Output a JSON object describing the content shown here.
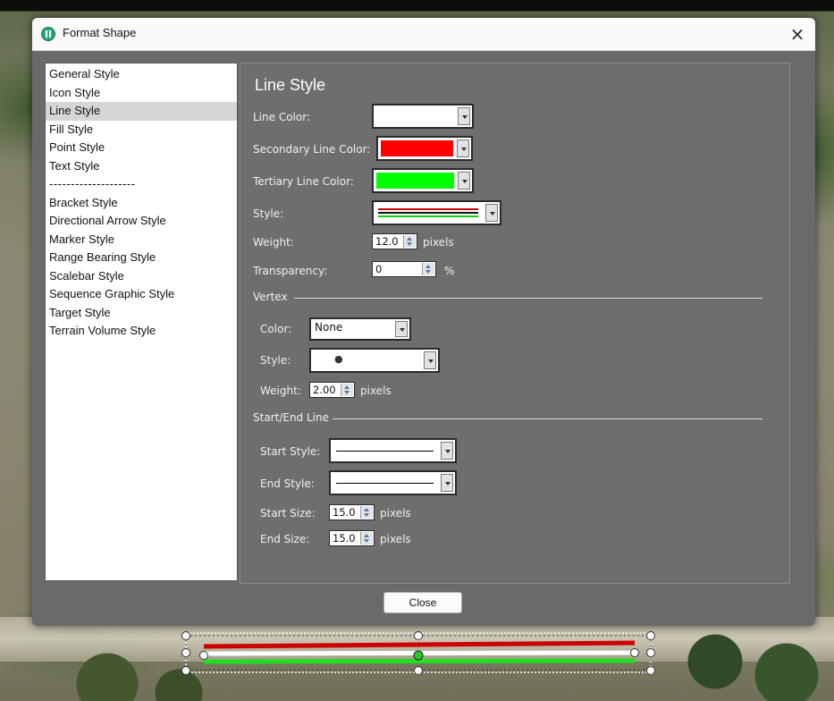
{
  "window": {
    "title": "Format Shape",
    "close_glyph": "×"
  },
  "style_list": {
    "items": [
      {
        "label": "General Style",
        "selected": false
      },
      {
        "label": "Icon Style",
        "selected": false
      },
      {
        "label": "Line Style",
        "selected": true
      },
      {
        "label": "Fill Style",
        "selected": false
      },
      {
        "label": "Point Style",
        "selected": false
      },
      {
        "label": "Text Style",
        "selected": false
      },
      {
        "label": "--------------------",
        "selected": false
      },
      {
        "label": "Bracket Style",
        "selected": false
      },
      {
        "label": "Directional Arrow Style",
        "selected": false
      },
      {
        "label": "Marker Style",
        "selected": false
      },
      {
        "label": "Range Bearing Style",
        "selected": false
      },
      {
        "label": "Scalebar Style",
        "selected": false
      },
      {
        "label": "Sequence Graphic Style",
        "selected": false
      },
      {
        "label": "Target Style",
        "selected": false
      },
      {
        "label": "Terrain Volume Style",
        "selected": false
      }
    ]
  },
  "line_style": {
    "heading": "Line Style",
    "line_color_label": "Line Color:",
    "line_color": "#ffffff",
    "secondary_color_label": "Secondary Line Color:",
    "secondary_color": "#ff0000",
    "tertiary_color_label": "Tertiary Line Color:",
    "tertiary_color": "#00ff00",
    "style_label": "Style:",
    "weight_label": "Weight:",
    "weight_value": "12.0",
    "weight_unit": "pixels",
    "transparency_label": "Transparency:",
    "transparency_value": "0",
    "transparency_unit": "%"
  },
  "vertex": {
    "section_label": "Vertex",
    "color_label": "Color:",
    "color_value": "None",
    "style_label": "Style:",
    "style_glyph": "●",
    "weight_label": "Weight:",
    "weight_value": "2.00",
    "weight_unit": "pixels"
  },
  "start_end": {
    "section_label": "Start/End Line",
    "start_style_label": "Start Style:",
    "end_style_label": "End Style:",
    "start_size_label": "Start Size:",
    "start_size_value": "15.0",
    "start_size_unit": "pixels",
    "end_size_label": "End Size:",
    "end_size_value": "15.0",
    "end_size_unit": "pixels"
  },
  "footer": {
    "close_label": "Close"
  },
  "icons": {
    "app": "app-globe-icon",
    "close": "close-icon",
    "dropdown": "chevron-down-icon",
    "spinner": "spinner-arrows-icon"
  }
}
